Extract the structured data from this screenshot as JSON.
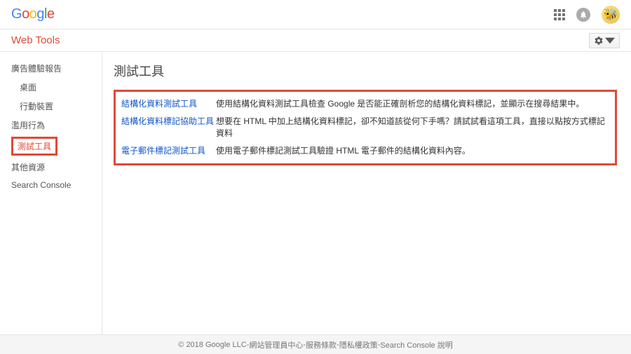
{
  "header": {
    "product_name": "Web Tools"
  },
  "sidebar": {
    "items": [
      {
        "label": "廣告體驗報告",
        "sub": false
      },
      {
        "label": "桌面",
        "sub": true
      },
      {
        "label": "行動裝置",
        "sub": true
      },
      {
        "label": "濫用行為",
        "sub": false
      },
      {
        "label": "測試工具",
        "sub": false,
        "active": true
      },
      {
        "label": "其他資源",
        "sub": false
      },
      {
        "label": "Search Console",
        "sub": false
      }
    ]
  },
  "main": {
    "title": "測試工具",
    "tools": [
      {
        "link": "結構化資料測試工具",
        "desc": "使用結構化資料測試工具檢查 Google 是否能正確剖析您的結構化資料標記，並顯示在搜尋結果中。"
      },
      {
        "link": "結構化資料標記協助工具",
        "desc": "想要在 HTML 中加上結構化資料標記，卻不知道該從何下手嗎？請試試看這項工具，直接以點按方式標記資料"
      },
      {
        "link": "電子郵件標記測試工具",
        "desc": "使用電子郵件標記測試工具驗證 HTML 電子郵件的結構化資料內容。"
      }
    ]
  },
  "footer": {
    "copyright": "© 2018 Google LLC",
    "links": [
      "網站管理員中心",
      "服務條款",
      "隱私權政策",
      "Search Console 說明"
    ],
    "sep": " - "
  }
}
